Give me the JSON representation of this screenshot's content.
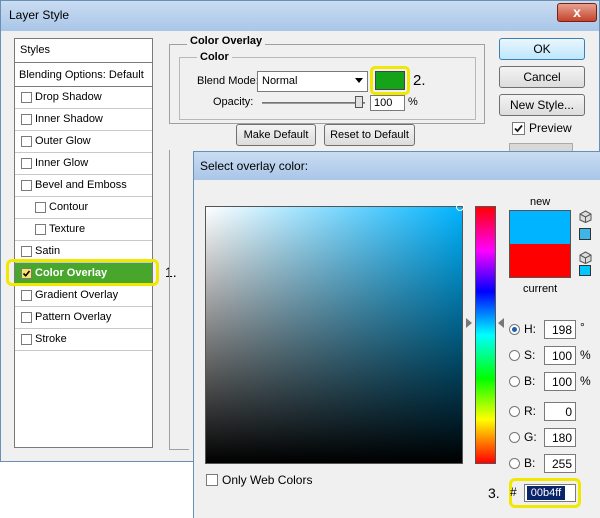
{
  "dialog": {
    "title": "Layer Style",
    "close_label": "x"
  },
  "styles_list": {
    "header": "Styles",
    "blending_options": "Blending Options: Default",
    "items": [
      {
        "label": "Drop Shadow",
        "checked": false
      },
      {
        "label": "Inner Shadow",
        "checked": false
      },
      {
        "label": "Outer Glow",
        "checked": false
      },
      {
        "label": "Inner Glow",
        "checked": false
      },
      {
        "label": "Bevel and Emboss",
        "checked": false
      },
      {
        "label": "Contour",
        "checked": false
      },
      {
        "label": "Texture",
        "checked": false
      },
      {
        "label": "Satin",
        "checked": false
      },
      {
        "label": "Color Overlay",
        "checked": true,
        "selected": true
      },
      {
        "label": "Gradient Overlay",
        "checked": false
      },
      {
        "label": "Pattern Overlay",
        "checked": false
      },
      {
        "label": "Stroke",
        "checked": false
      }
    ]
  },
  "annotations": {
    "step1": "1.",
    "step2": "2.",
    "step3": "3."
  },
  "color_overlay": {
    "group_title": "Color Overlay",
    "color_title": "Color",
    "blend_mode_label": "Blend Mode:",
    "blend_mode_value": "Normal",
    "swatch_color": "#15a31a",
    "opacity_label": "Opacity:",
    "opacity_value": "100",
    "opacity_unit": "%",
    "opacity_fraction": 1.0,
    "make_default": "Make Default",
    "reset_default": "Reset to Default"
  },
  "buttons": {
    "ok": "OK",
    "cancel": "Cancel",
    "new_style": "New Style...",
    "preview": "Preview"
  },
  "color_picker": {
    "title": "Select overlay color:",
    "new_label": "new",
    "current_label": "current",
    "new_color": "#00b4ff",
    "current_color": "#ff0000",
    "fields": {
      "h": {
        "label": "H:",
        "value": "198",
        "unit": "°"
      },
      "s": {
        "label": "S:",
        "value": "100",
        "unit": "%"
      },
      "b": {
        "label": "B:",
        "value": "100",
        "unit": "%"
      },
      "r": {
        "label": "R:",
        "value": "0"
      },
      "g": {
        "label": "G:",
        "value": "180"
      },
      "b2": {
        "label": "B:",
        "value": "255"
      }
    },
    "hex_hash": "#",
    "hex_value": "00b4ff",
    "only_web_colors": "Only Web Colors"
  }
}
